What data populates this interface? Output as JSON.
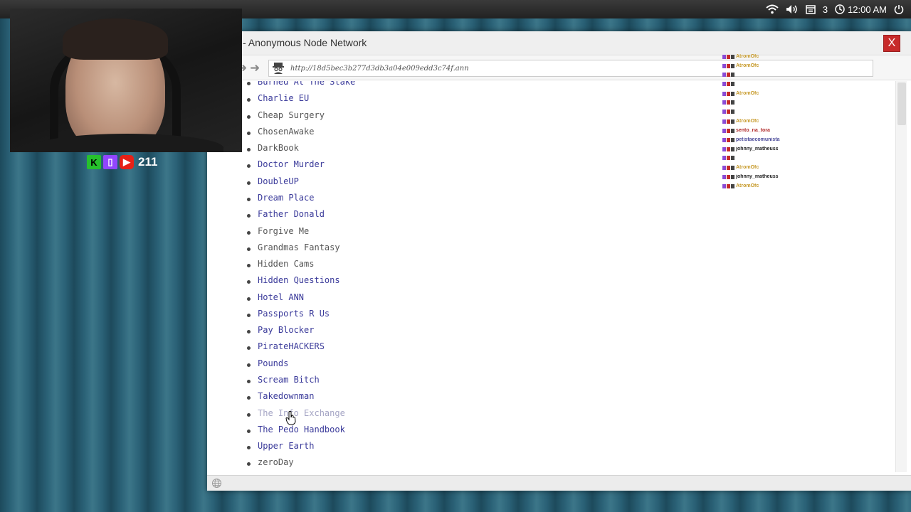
{
  "system_bar": {
    "calendar_count": "3",
    "clock": "12:00 AM"
  },
  "window": {
    "title": "- Anonymous Node Network",
    "close_label": "X",
    "url": "http://18d5bec3b277d3db3a04e009edd3c74f.ann"
  },
  "site_list": [
    {
      "label": "Burned At The Stake",
      "style": "link"
    },
    {
      "label": "Charlie EU",
      "style": "link"
    },
    {
      "label": "Cheap Surgery",
      "style": "plain"
    },
    {
      "label": "ChosenAwake",
      "style": "plain"
    },
    {
      "label": "DarkBook",
      "style": "plain"
    },
    {
      "label": "Doctor Murder",
      "style": "link"
    },
    {
      "label": "DoubleUP",
      "style": "link"
    },
    {
      "label": "Dream Place",
      "style": "link"
    },
    {
      "label": "Father Donald",
      "style": "link"
    },
    {
      "label": "Forgive Me",
      "style": "plain"
    },
    {
      "label": "Grandmas Fantasy",
      "style": "plain"
    },
    {
      "label": "Hidden Cams",
      "style": "plain"
    },
    {
      "label": "Hidden Questions",
      "style": "link"
    },
    {
      "label": "Hotel ANN",
      "style": "link"
    },
    {
      "label": "Passports R Us",
      "style": "link"
    },
    {
      "label": "Pay Blocker",
      "style": "link"
    },
    {
      "label": "PirateHACKERS",
      "style": "link"
    },
    {
      "label": "Pounds",
      "style": "link"
    },
    {
      "label": "Scream Bitch",
      "style": "link"
    },
    {
      "label": "Takedownman",
      "style": "link"
    },
    {
      "label": "The Info Exchange",
      "style": "visited"
    },
    {
      "label": "The Pedo Handbook",
      "style": "link"
    },
    {
      "label": "Upper Earth",
      "style": "link"
    },
    {
      "label": "zeroDay",
      "style": "plain"
    }
  ],
  "stream": {
    "viewer_count": "211",
    "platforms": [
      "kick-icon",
      "twitch-icon",
      "youtube-icon"
    ]
  },
  "chat": [
    {
      "user": "AtromOfc",
      "color": "#c79a2a",
      "msg": ""
    },
    {
      "user": "AtromOfc",
      "color": "#c79a2a",
      "msg": ""
    },
    {
      "user": "",
      "color": "#888888",
      "msg": ""
    },
    {
      "user": "",
      "color": "#888888",
      "msg": ""
    },
    {
      "user": "AtromOfc",
      "color": "#c79a2a",
      "msg": ""
    },
    {
      "user": "",
      "color": "#2ab43c",
      "msg": ""
    },
    {
      "user": "",
      "color": "#888888",
      "msg": ""
    },
    {
      "user": "AtromOfc",
      "color": "#c79a2a",
      "msg": ""
    },
    {
      "user": "sento_na_tora",
      "color": "#b02a2a",
      "msg": ""
    },
    {
      "user": "petistaecomunista",
      "color": "#4a4a9a",
      "msg": ""
    },
    {
      "user": "johnny_matheuss",
      "color": "#222222",
      "msg": ""
    },
    {
      "user": "",
      "color": "#2ab43c",
      "msg": ""
    },
    {
      "user": "AtromOfc",
      "color": "#c79a2a",
      "msg": ""
    },
    {
      "user": "johnny_matheuss",
      "color": "#222222",
      "msg": ""
    },
    {
      "user": "AtromOfc",
      "color": "#c79a2a",
      "msg": ""
    }
  ],
  "colors": {
    "link": "#3a3a9a",
    "visited": "#a4a4c4",
    "close_button": "#c72b2b"
  }
}
